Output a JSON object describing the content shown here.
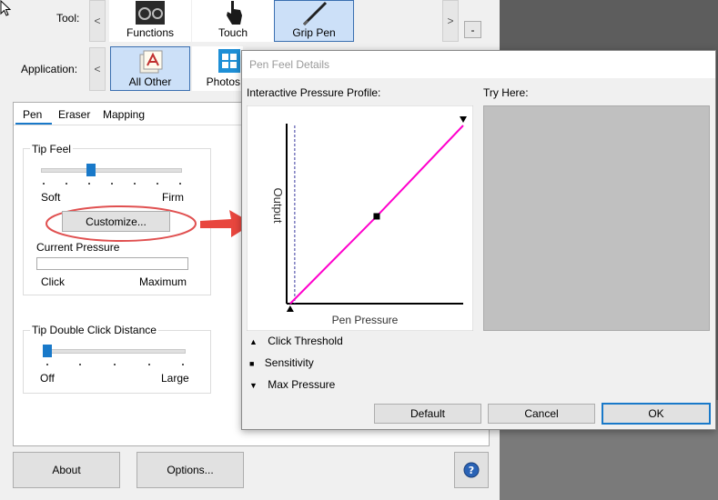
{
  "main": {
    "tool_label": "Tool:",
    "application_label": "Application:",
    "scroll_left": "<",
    "scroll_right": ">",
    "minus": "-",
    "tools": [
      {
        "label": "Functions",
        "icon": "functions-icon"
      },
      {
        "label": "Touch",
        "icon": "touch-hand-icon"
      },
      {
        "label": "Grip Pen",
        "icon": "pen-icon"
      }
    ],
    "applications": [
      {
        "label": "All Other",
        "icon": "all-other-apps-icon"
      },
      {
        "label": "Photos",
        "icon": "photos-app-icon"
      }
    ],
    "tabs": [
      "Pen",
      "Eraser",
      "Mapping"
    ],
    "tip_feel": {
      "title": "Tip Feel",
      "soft": "Soft",
      "firm": "Firm",
      "level": 0.33,
      "customize": "Customize...",
      "current_pressure": "Current Pressure",
      "click": "Click",
      "maximum": "Maximum"
    },
    "double_click": {
      "title": "Tip Double Click Distance",
      "off": "Off",
      "large": "Large",
      "level": 0.0
    },
    "about": "About",
    "options": "Options...",
    "help_icon": "help-icon"
  },
  "dialog": {
    "title": "Pen Feel Details",
    "profile_label": "Interactive Pressure Profile:",
    "try_here_label": "Try Here:",
    "x_axis": "Pen Pressure",
    "y_axis": "Output",
    "legend": [
      {
        "symbol": "▲",
        "label": "Click Threshold"
      },
      {
        "symbol": "■",
        "label": "Sensitivity"
      },
      {
        "symbol": "▼",
        "label": "Max Pressure"
      }
    ],
    "default_btn": "Default",
    "cancel_btn": "Cancel",
    "ok_btn": "OK",
    "curve_color": "#ff00cc"
  },
  "chart_data": {
    "type": "line",
    "title": "",
    "xlabel": "Pen Pressure",
    "ylabel": "Output",
    "xlim": [
      0,
      1
    ],
    "ylim": [
      0,
      1
    ],
    "series": [
      {
        "x": [
          0.02,
          0.51,
          1.0
        ],
        "y": [
          0.0,
          0.49,
          1.0
        ]
      }
    ],
    "control_points": {
      "click_threshold": [
        0.02,
        0.0
      ],
      "sensitivity": [
        0.51,
        0.49
      ],
      "max_pressure": [
        1.0,
        1.0
      ]
    }
  }
}
